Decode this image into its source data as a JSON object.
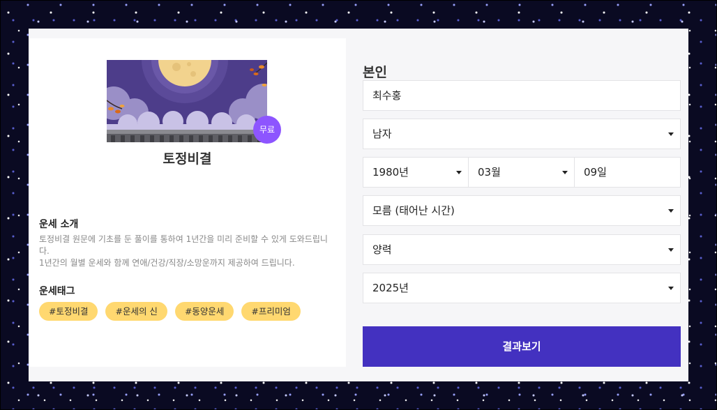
{
  "product": {
    "title": "토정비결",
    "badge": "무료"
  },
  "intro": {
    "heading": "운세 소개",
    "lines": [
      "토정비결 원문에 기초를 둔 풀이를 통하여 1년간을 미리 준비할 수 있게 도와드립니다.",
      "1년간의 월별 운세와 함께 연애/건강/직장/소망운까지 제공하여 드립니다."
    ]
  },
  "tags": {
    "heading": "운세태그",
    "items": [
      "#토정비결",
      "#운세의 신",
      "#동양운세",
      "#프리미엄"
    ]
  },
  "form": {
    "title": "본인",
    "name_value": "최수홍",
    "gender_value": "남자",
    "birth_year_value": "1980년",
    "birth_month_value": "03월",
    "birth_day_value": "09일",
    "birth_time_value": "모름 (태어난 시간)",
    "calendar_value": "양력",
    "target_year_value": "2025년",
    "submit_label": "결과보기"
  },
  "colors": {
    "accent": "#4331c0",
    "badge": "#8d55ff",
    "tag": "#ffd870",
    "banner_sky": "#4d3d8a",
    "moon": "#f2d38e"
  },
  "icons": [
    "full-moon-illustration",
    "cloud-icon",
    "autumn-leaf-icon",
    "dropdown-caret-icon"
  ]
}
